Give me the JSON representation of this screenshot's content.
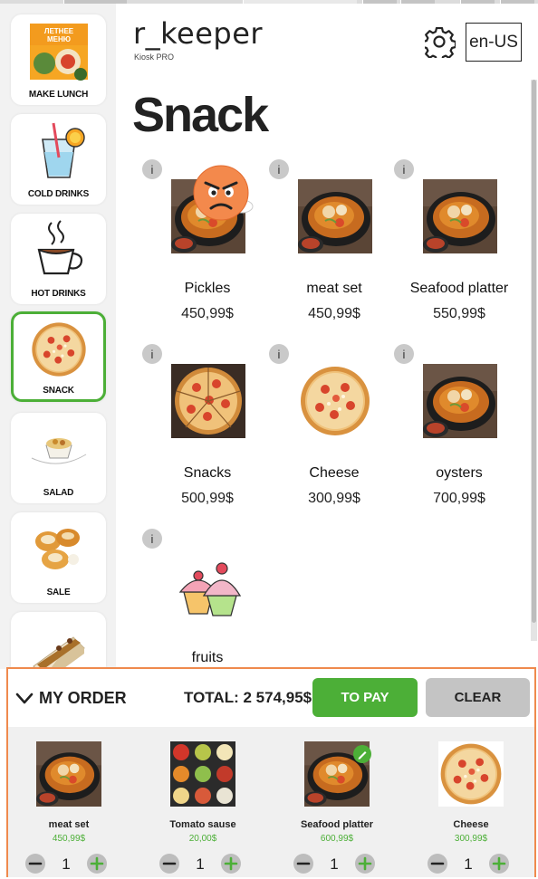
{
  "app": {
    "brand": "r_keeper",
    "subtitle": "Kiosk PRO",
    "language": "en-US",
    "settings_icon": "gear-icon"
  },
  "categories": [
    {
      "label": "MAKE LUNCH",
      "icon": "lunch-menu-image",
      "active": false
    },
    {
      "label": "COLD DRINKS",
      "icon": "cold-drink-image",
      "active": false
    },
    {
      "label": "HOT DRINKS",
      "icon": "hot-cup-image",
      "active": false
    },
    {
      "label": "SNACK",
      "icon": "pizza-image",
      "active": true
    },
    {
      "label": "SALAD",
      "icon": "salad-bowl-image",
      "active": false
    },
    {
      "label": "SALE",
      "icon": "pastry-image",
      "active": false
    },
    {
      "label": "",
      "icon": "cake-slice-image",
      "active": false
    }
  ],
  "page_title": "Snack",
  "products": [
    {
      "name": "Pickles",
      "price": "450,99$",
      "image": "stew-bowl-image",
      "info": "i",
      "overlay": "angry-emoji-icon"
    },
    {
      "name": "meat set",
      "price": "450,99$",
      "image": "stew-bowl-image",
      "info": "i"
    },
    {
      "name": "Seafood platter",
      "price": "550,99$",
      "image": "stew-bowl-image",
      "info": "i"
    },
    {
      "name": "Snacks",
      "price": "500,99$",
      "image": "pizza-slices-image",
      "info": "i"
    },
    {
      "name": "Cheese",
      "price": "300,99$",
      "image": "pizza-image",
      "info": "i"
    },
    {
      "name": "oysters",
      "price": "700,99$",
      "image": "stew-bowl-image",
      "info": "i"
    },
    {
      "name": "fruits",
      "price": "",
      "image": "cupcakes-image",
      "info": "i"
    }
  ],
  "order": {
    "title": "MY ORDER",
    "total_label": "TOTAL:",
    "total_value": "2 574,95$",
    "pay_label": "TO PAY",
    "clear_label": "CLEAR",
    "items": [
      {
        "name": "meat set",
        "price": "450,99$",
        "qty": "1",
        "image": "stew-bowl-image"
      },
      {
        "name": "Tomato sause",
        "price": "20,00$",
        "qty": "1",
        "image": "sauces-image"
      },
      {
        "name": "Seafood platter",
        "price": "600,99$",
        "qty": "1",
        "image": "stew-bowl-image",
        "edit": "pencil-icon"
      },
      {
        "name": "Cheese",
        "price": "300,99$",
        "qty": "1",
        "image": "pizza-image"
      }
    ]
  },
  "colors": {
    "accent_green": "#4caf37",
    "order_border": "#ef8a4d",
    "clear_gray": "#c4c4c4"
  }
}
